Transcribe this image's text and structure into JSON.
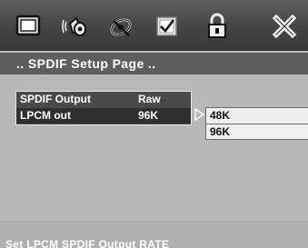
{
  "toolbar": {
    "icons": [
      "monitor-icon",
      "speaker-icon",
      "satellite-icon",
      "checkbox-icon",
      "lock-icon",
      "close-icon"
    ]
  },
  "page_title": ".. SPDIF Setup Page ..",
  "settings": [
    {
      "label": "SPDIF Output",
      "value": "Raw"
    },
    {
      "label": "LPCM out",
      "value": "96K"
    }
  ],
  "submenu": {
    "options": [
      "48K",
      "96K"
    ],
    "highlighted": "48K"
  },
  "status_text": "Set LPCM SPDIF Output RATE",
  "colors": {
    "background": "#b8b8b8",
    "header": "#444444",
    "title_bar": "#5e5e5e",
    "panel": "#4a4a4a",
    "submenu": "#efefef"
  }
}
